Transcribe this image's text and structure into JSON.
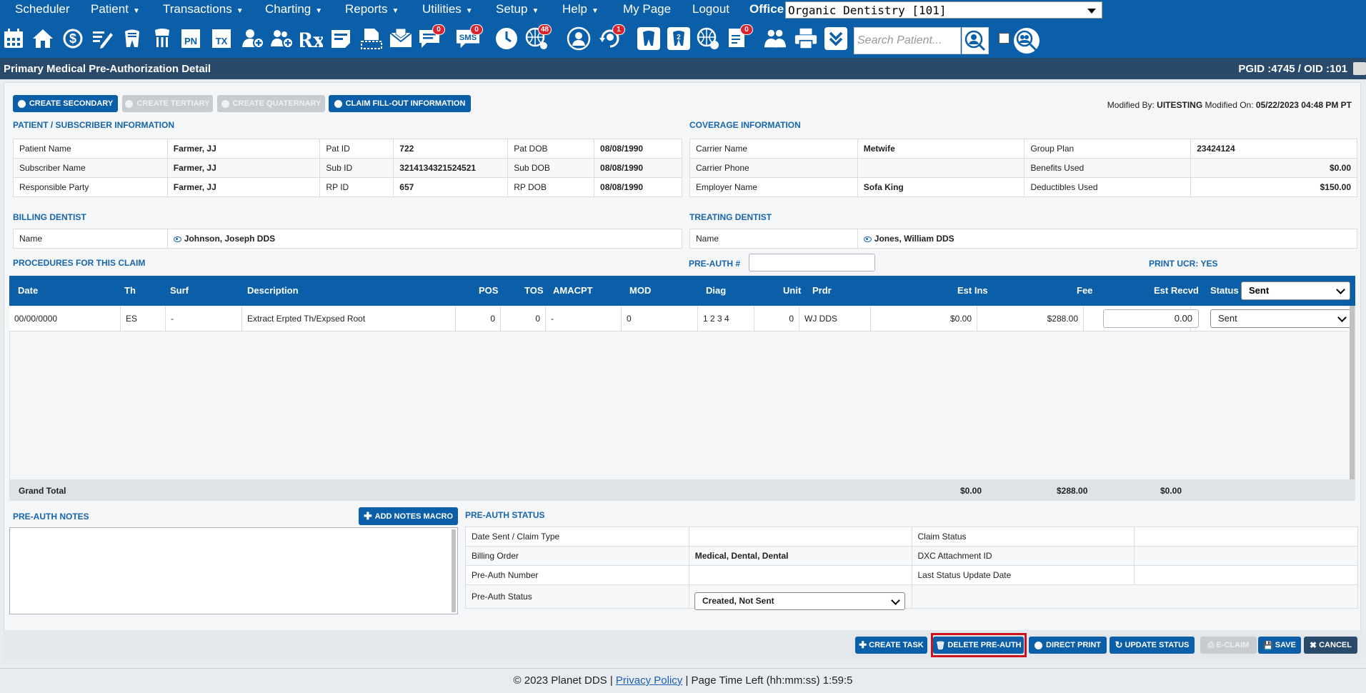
{
  "top_menu": {
    "items": [
      {
        "label": "Scheduler",
        "caret": false
      },
      {
        "label": "Patient",
        "caret": true
      },
      {
        "label": "Transactions",
        "caret": true
      },
      {
        "label": "Charting",
        "caret": true
      },
      {
        "label": "Reports",
        "caret": true
      },
      {
        "label": "Utilities",
        "caret": true
      },
      {
        "label": "Setup",
        "caret": true
      },
      {
        "label": "Help",
        "caret": true
      },
      {
        "label": "My Page",
        "caret": false
      },
      {
        "label": "Logout",
        "caret": false
      }
    ],
    "office_label": "Office",
    "office_value": "Organic Dentistry [101]"
  },
  "toolbar": {
    "badges": {
      "messages": "0",
      "sms": "0",
      "world": "48",
      "help": "1",
      "doc": "0"
    },
    "sms_label": "SMS",
    "pn_label": "PN",
    "tx_label": "TX",
    "rx_label": "Rx",
    "search_placeholder": "Search Patient..."
  },
  "title": {
    "text": "Primary Medical Pre-Authorization Detail",
    "ids": "PGID :4745  /  OID :101"
  },
  "top_buttons": {
    "create_secondary": "CREATE SECONDARY",
    "create_tertiary": "CREATE TERTIARY",
    "create_quaternary": "CREATE QUATERNARY",
    "claim_fill_out": "CLAIM FILL-OUT INFORMATION"
  },
  "modified": {
    "by_label": "Modified By:",
    "by_value": "UITESTING",
    "on_label": "Modified On:",
    "on_value": "05/22/2023 04:48 PM PT"
  },
  "patient_info": {
    "heading": "PATIENT / SUBSCRIBER INFORMATION",
    "rows": [
      [
        "Patient Name",
        "Farmer, JJ",
        "Pat ID",
        "722",
        "Pat DOB",
        "08/08/1990"
      ],
      [
        "Subscriber Name",
        "Farmer, JJ",
        "Sub ID",
        "3214134321524521",
        "Sub DOB",
        "08/08/1990"
      ],
      [
        "Responsible Party",
        "Farmer, JJ",
        "RP ID",
        "657",
        "RP DOB",
        "08/08/1990"
      ]
    ]
  },
  "coverage_info": {
    "heading": "COVERAGE INFORMATION",
    "rows": [
      [
        "Carrier Name",
        "Metwife",
        "Group Plan",
        "23424124"
      ],
      [
        "Carrier Phone",
        "",
        "Benefits Used",
        "$0.00"
      ],
      [
        "Employer Name",
        "Sofa King",
        "Deductibles Used",
        "$150.00"
      ]
    ]
  },
  "billing_dentist": {
    "heading": "BILLING DENTIST",
    "label": "Name",
    "value": "Johnson, Joseph DDS"
  },
  "treating_dentist": {
    "heading": "TREATING DENTIST",
    "label": "Name",
    "value": "Jones, William DDS"
  },
  "procedures": {
    "heading": "PROCEDURES FOR THIS CLAIM",
    "preauth_label": "PRE-AUTH #",
    "preauth_value": "",
    "print_ucr": "PRINT UCR: YES",
    "columns": [
      "Date",
      "Th",
      "Surf",
      "Description",
      "POS",
      "TOS",
      "AMACPT",
      "MOD",
      "Diag",
      "Unit",
      "Prdr",
      "Est Ins",
      "Fee",
      "Est Recvd",
      "Status"
    ],
    "header_status": "Sent",
    "rows": [
      {
        "date": "00/00/0000",
        "th": "ES",
        "surf": "-",
        "desc": "Extract Erpted Th/Expsed Root",
        "pos": "0",
        "tos": "0",
        "amacpt": "-",
        "mod": "0",
        "diag": "1 2 3 4",
        "unit": "0",
        "prdr": "WJ DDS",
        "est_ins": "$0.00",
        "fee": "$288.00",
        "est_recvd": "0.00",
        "status": "Sent"
      }
    ],
    "grand_total": {
      "label": "Grand Total",
      "est_ins": "$0.00",
      "fee": "$288.00",
      "est_recvd": "$0.00"
    }
  },
  "notes": {
    "heading": "PRE-AUTH NOTES",
    "macro_button": "ADD NOTES MACRO",
    "text": ""
  },
  "status": {
    "heading": "PRE-AUTH STATUS",
    "rows": [
      [
        "Date Sent / Claim Type",
        "",
        "Claim Status",
        ""
      ],
      [
        "Billing Order",
        "Medical, Dental, Dental",
        "DXC Attachment ID",
        ""
      ],
      [
        "Pre-Auth Number",
        "",
        "Last Status Update Date",
        ""
      ]
    ],
    "preauth_status_label": "Pre-Auth Status",
    "preauth_status_value": "Created, Not Sent"
  },
  "bottom_buttons": {
    "create_task": "CREATE TASK",
    "delete_preauth": "DELETE PRE-AUTH",
    "direct_print": "DIRECT PRINT",
    "update_status": "UPDATE STATUS",
    "eclaim": "E-CLAIM",
    "save": "SAVE",
    "cancel": "CANCEL"
  },
  "footer": {
    "copyright": "© 2023 Planet DDS |",
    "privacy": "Privacy Policy",
    "time_left": "|  Page Time Left (hh:mm:ss) 1:59:5"
  },
  "colors": {
    "brand": "#0b5ea8",
    "title_bar": "#2a4a6b",
    "highlight": "#cc1120",
    "badge": "#d9232d"
  }
}
